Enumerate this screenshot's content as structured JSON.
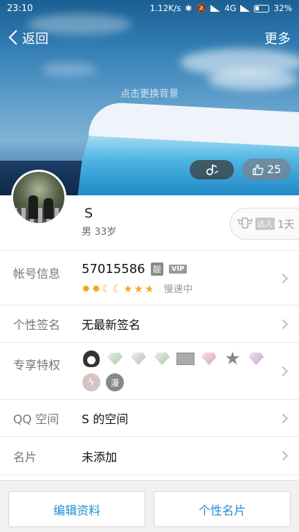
{
  "status_bar": {
    "time": "23:10",
    "net_speed": "1.12K/s",
    "network": "4G",
    "battery": "32%"
  },
  "nav": {
    "back_label": "返回",
    "more_label": "更多"
  },
  "cover": {
    "change_bg_hint": "点击更换背景"
  },
  "like": {
    "count": "25"
  },
  "profile": {
    "nickname": "S",
    "gender_age": "男 33岁",
    "talent_tag": "达人",
    "talent_days": "1天"
  },
  "account": {
    "label": "帐号信息",
    "qq_number": "57015586",
    "badge_liang": "靓",
    "badge_vip": "VIP",
    "speed_text": "慢速中"
  },
  "signature": {
    "label": "个性签名",
    "value": "无最新签名"
  },
  "privileges": {
    "label": "专享特权"
  },
  "qzone": {
    "label": "QQ 空间",
    "value": "S 的空间"
  },
  "card": {
    "label": "名片",
    "value": "未添加"
  },
  "buttons": {
    "edit_profile": "编辑资料",
    "personal_card": "个性名片"
  },
  "colors": {
    "accent": "#1f8fd6"
  }
}
